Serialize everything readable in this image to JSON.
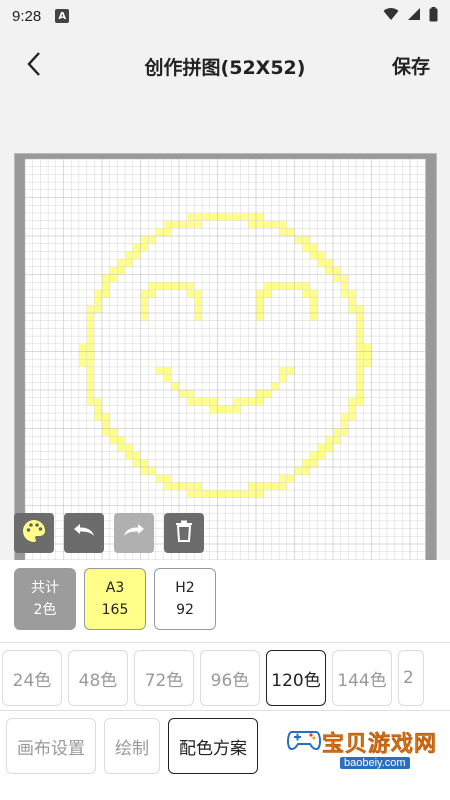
{
  "status": {
    "time": "9:28",
    "badge": "A"
  },
  "header": {
    "title": "创作拼图(52X52)",
    "save_label": "保存"
  },
  "colors": {
    "accent_yellow": "#ffff8a",
    "tool_gray": "#6c6c6c"
  },
  "tools": [
    {
      "name": "palette-icon"
    },
    {
      "name": "undo-icon"
    },
    {
      "name": "redo-icon",
      "disabled": true
    },
    {
      "name": "trash-icon"
    }
  ],
  "counts": {
    "total": {
      "line1": "共计",
      "line2": "2色"
    },
    "a3": {
      "code": "A3",
      "count": "165"
    },
    "h2": {
      "code": "H2",
      "count": "92"
    }
  },
  "palettes": [
    "24色",
    "48色",
    "72色",
    "96色",
    "120色",
    "144色",
    "2"
  ],
  "selected_palette": "120色",
  "actions": [
    "画布设置",
    "绘制",
    "配色方案"
  ],
  "selected_action": "配色方案",
  "watermark": {
    "text": "宝贝游戏网",
    "url": "baobeiy.com"
  }
}
